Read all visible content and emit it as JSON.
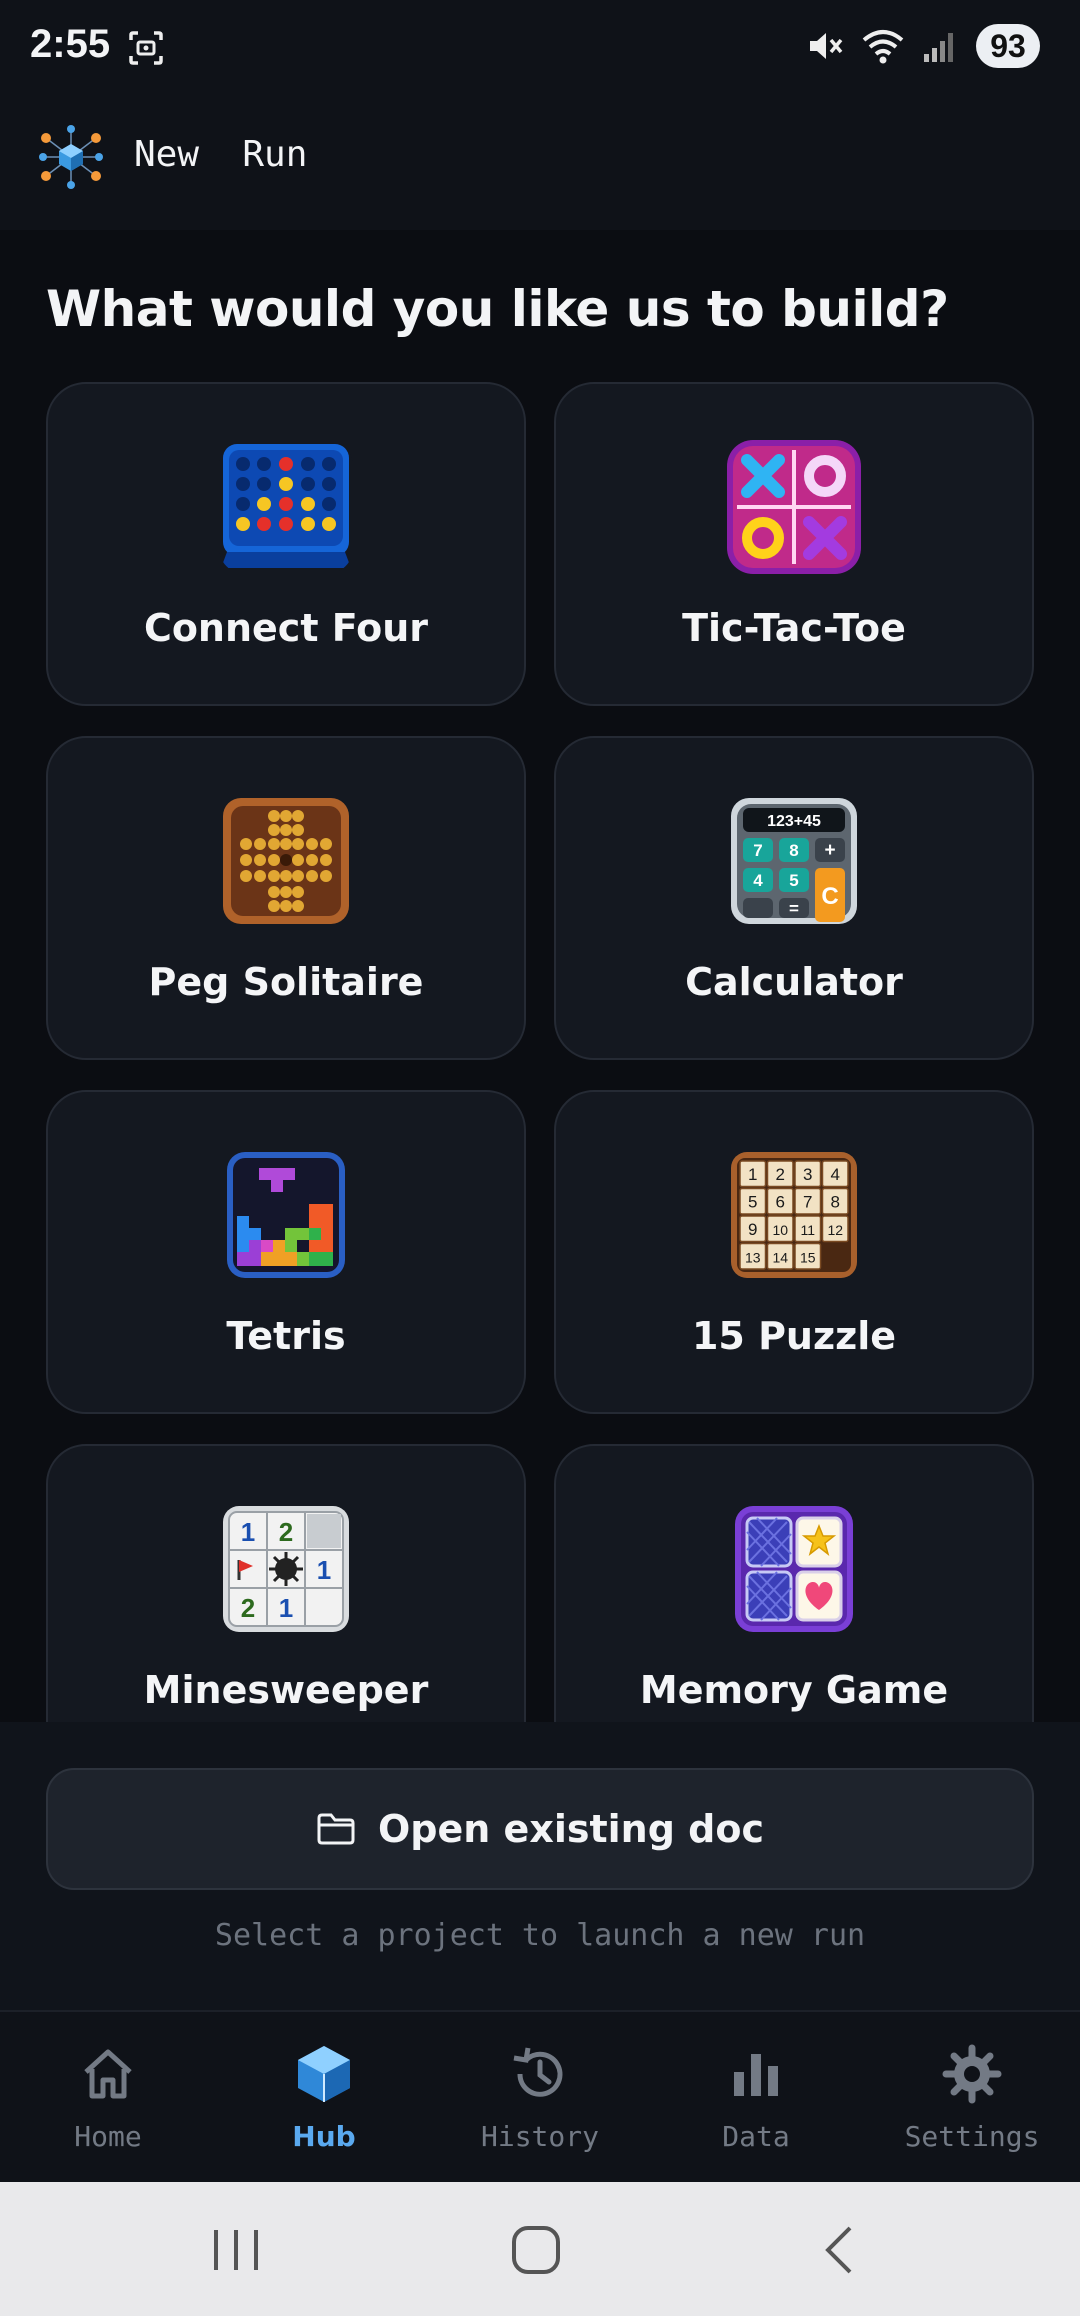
{
  "status_bar": {
    "time": "2:55",
    "battery": "93"
  },
  "app": {
    "title": "New  Run"
  },
  "main": {
    "heading": "What would you like us to build?",
    "projects": [
      {
        "label": "Connect Four",
        "icon": "connect-four-icon"
      },
      {
        "label": "Tic-Tac-Toe",
        "icon": "tic-tac-toe-icon"
      },
      {
        "label": "Peg Solitaire",
        "icon": "peg-solitaire-icon"
      },
      {
        "label": "Calculator",
        "icon": "calculator-icon",
        "display": "123+45",
        "keys": [
          "7",
          "8",
          "+",
          "4",
          "5",
          "C",
          "",
          "=",
          ""
        ]
      },
      {
        "label": "Tetris",
        "icon": "tetris-icon"
      },
      {
        "label": "15 Puzzle",
        "icon": "fifteen-puzzle-icon",
        "tiles": [
          "1",
          "2",
          "3",
          "4",
          "5",
          "6",
          "7",
          "8",
          "9",
          "10",
          "11",
          "12",
          "13",
          "14",
          "15"
        ]
      },
      {
        "label": "Minesweeper",
        "icon": "minesweeper-icon",
        "cells": [
          "1",
          "2",
          "",
          "",
          "",
          "1",
          "2",
          "1",
          ""
        ]
      },
      {
        "label": "Memory Game",
        "icon": "memory-game-icon"
      }
    ]
  },
  "footer": {
    "open_button": "Open existing doc",
    "hint": "Select a project to launch a new run"
  },
  "bottom_nav": {
    "active": "Hub",
    "items": [
      {
        "label": "Home",
        "icon": "home-icon"
      },
      {
        "label": "Hub",
        "icon": "cube-icon"
      },
      {
        "label": "History",
        "icon": "history-icon"
      },
      {
        "label": "Data",
        "icon": "bar-chart-icon"
      },
      {
        "label": "Settings",
        "icon": "gear-icon"
      }
    ]
  },
  "colors": {
    "accent": "#5aa9ef",
    "background": "#0b0d12",
    "card": "#141820"
  }
}
